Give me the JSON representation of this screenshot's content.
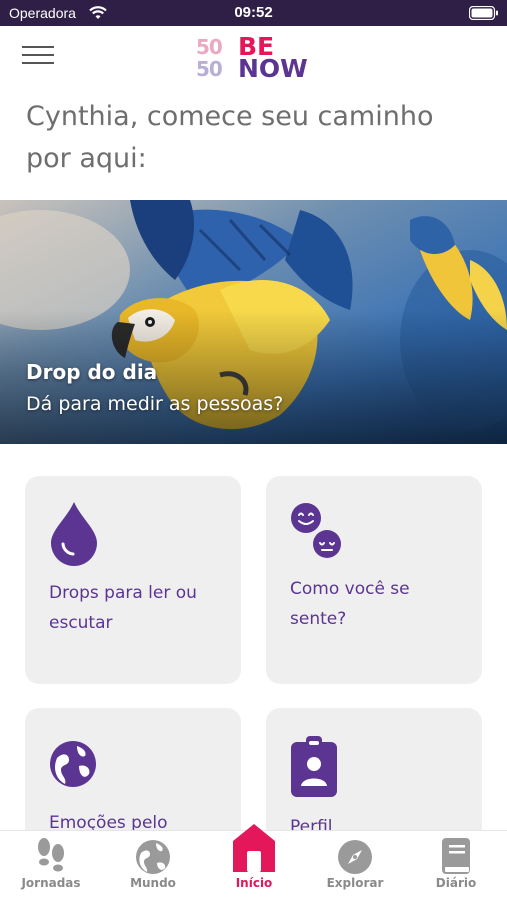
{
  "status_bar": {
    "carrier": "Operadora",
    "time": "09:52"
  },
  "header": {
    "logo": {
      "num_top": "50",
      "num_bottom": "50",
      "word_top": "BE",
      "word_bottom": "NOW"
    }
  },
  "greeting": "Cynthia, comece seu caminho por aqui:",
  "hero": {
    "title": "Drop do dia",
    "subtitle": "Dá para medir as pessoas?",
    "pages": 3,
    "active_page": 2
  },
  "cards": [
    {
      "label": "Drops para ler ou escutar",
      "icon": "drop-icon"
    },
    {
      "label": "Como você se sente?",
      "icon": "emotions-faces-icon"
    },
    {
      "label": "Emoções pelo",
      "icon": "globe-icon"
    },
    {
      "label": "Perfil",
      "icon": "badge-profile-icon"
    }
  ],
  "tabs": [
    {
      "label": "Jornadas",
      "icon": "footprints-icon"
    },
    {
      "label": "Mundo",
      "icon": "globe-icon"
    },
    {
      "label": "Início",
      "icon": "home-icon",
      "active": true
    },
    {
      "label": "Explorar",
      "icon": "compass-icon"
    },
    {
      "label": "Diário",
      "icon": "book-icon"
    }
  ],
  "colors": {
    "brand_purple": "#5b3591",
    "brand_pink": "#e4175a",
    "status_bar": "#2f1f47",
    "card_bg": "#efefef"
  }
}
